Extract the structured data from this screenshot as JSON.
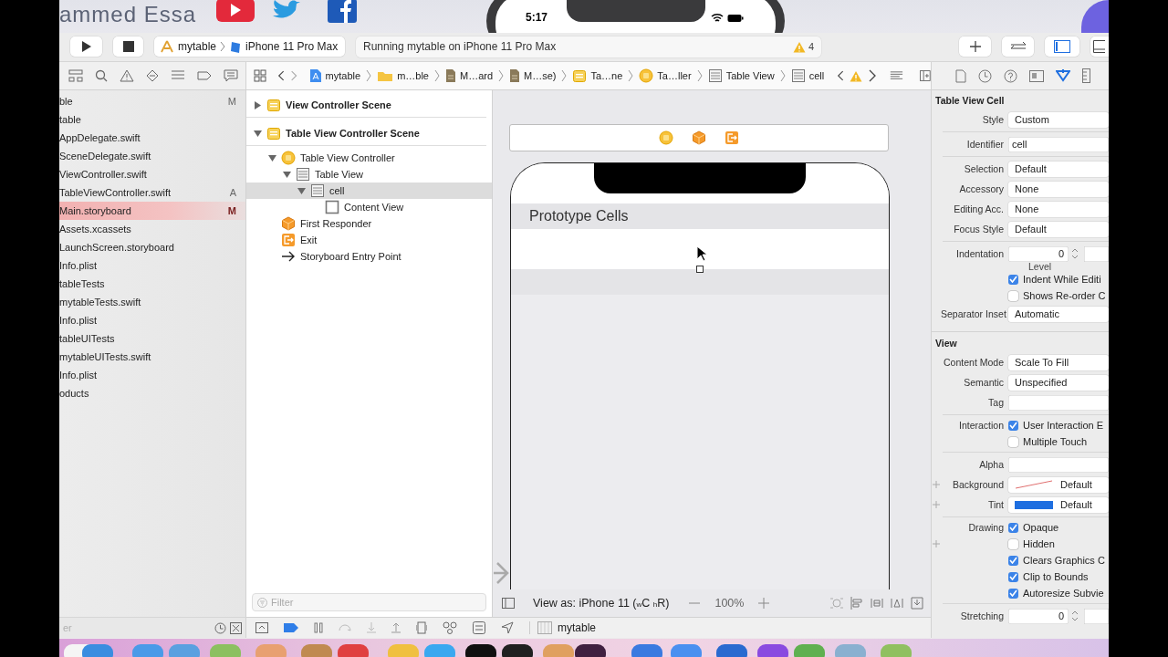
{
  "video_header": {
    "channel_name": "ammed Essa"
  },
  "simulator": {
    "time": "5:17"
  },
  "toolbar": {
    "scheme": "mytable",
    "device": "iPhone 11 Pro Max",
    "status": "Running mytable on iPhone 11 Pro Max",
    "warning_count": "4"
  },
  "jump_bar": {
    "path": [
      {
        "kind": "project",
        "label": "mytable"
      },
      {
        "kind": "folder",
        "label": "m…ble"
      },
      {
        "kind": "file",
        "label": "M…ard"
      },
      {
        "kind": "file",
        "label": "M…se)"
      },
      {
        "kind": "scene",
        "label": "Ta…ne"
      },
      {
        "kind": "controller",
        "label": "Ta…ller"
      },
      {
        "kind": "table",
        "label": "Table View"
      },
      {
        "kind": "table",
        "label": "cell"
      }
    ]
  },
  "navigator": {
    "files": [
      {
        "name": "ble",
        "badge": "M",
        "selected": false
      },
      {
        "name": "table",
        "selected": false
      },
      {
        "name": "AppDelegate.swift",
        "selected": false
      },
      {
        "name": "SceneDelegate.swift",
        "selected": false
      },
      {
        "name": "ViewController.swift",
        "selected": false
      },
      {
        "name": "TableViewController.swift",
        "badge": "A",
        "selected": false
      },
      {
        "name": "Main.storyboard",
        "badge": "M",
        "selected": true
      },
      {
        "name": "Assets.xcassets",
        "selected": false
      },
      {
        "name": "LaunchScreen.storyboard",
        "selected": false
      },
      {
        "name": "Info.plist",
        "selected": false
      },
      {
        "name": "tableTests",
        "selected": false
      },
      {
        "name": "mytableTests.swift",
        "selected": false
      },
      {
        "name": "Info.plist",
        "selected": false
      },
      {
        "name": "tableUITests",
        "selected": false
      },
      {
        "name": "mytableUITests.swift",
        "selected": false
      },
      {
        "name": "Info.plist",
        "selected": false
      },
      {
        "name": "oducts",
        "selected": false
      }
    ],
    "filter_placeholder": "er"
  },
  "outline": {
    "items": [
      {
        "kind": "scene",
        "label": "View Controller Scene",
        "expanded": false,
        "selected": false
      },
      {
        "kind": "scene",
        "label": "Table View Controller Scene",
        "expanded": true,
        "selected": false,
        "children": [
          {
            "kind": "controller",
            "label": "Table View Controller",
            "expanded": true,
            "selected": false,
            "children": [
              {
                "kind": "table",
                "label": "Table View",
                "expanded": true,
                "selected": false,
                "children": [
                  {
                    "kind": "table",
                    "label": "cell",
                    "expanded": true,
                    "selected": true,
                    "children": [
                      {
                        "kind": "view",
                        "label": "Content View",
                        "selected": false
                      }
                    ]
                  }
                ]
              }
            ]
          },
          {
            "kind": "responder",
            "label": "First Responder",
            "selected": false
          },
          {
            "kind": "exit",
            "label": "Exit",
            "selected": false
          },
          {
            "kind": "entry",
            "label": "Storyboard Entry Point",
            "selected": false
          }
        ]
      }
    ],
    "filter_placeholder": "Filter"
  },
  "canvas": {
    "section_header": "Prototype Cells",
    "view_as": "View as: iPhone 11 ($_{w}$C $_{h}$R)",
    "zoom": "100%"
  },
  "debug_bar": {
    "target": "mytable"
  },
  "inspector": {
    "sections": [
      {
        "title": "Table View Cell",
        "rows": [
          {
            "kind": "popup",
            "label": "Style",
            "value": "Custom"
          },
          {
            "kind": "divider"
          },
          {
            "kind": "field",
            "label": "Identifier",
            "value": "cell"
          },
          {
            "kind": "divider"
          },
          {
            "kind": "popup",
            "label": "Selection",
            "value": "Default"
          },
          {
            "kind": "popup",
            "label": "Accessory",
            "value": "None"
          },
          {
            "kind": "popup",
            "label": "Editing Acc.",
            "value": "None"
          },
          {
            "kind": "popup",
            "label": "Focus Style",
            "value": "Default"
          },
          {
            "kind": "divider"
          },
          {
            "kind": "stepper",
            "label": "Indentation",
            "value": "0",
            "sublabel": "Level"
          },
          {
            "kind": "checkbox",
            "text": "Indent While Editi",
            "checked": true
          },
          {
            "kind": "checkbox",
            "text": "Shows Re-order C",
            "checked": false
          },
          {
            "kind": "popup",
            "label": "Separator Inset",
            "value": "Automatic"
          }
        ]
      },
      {
        "title": "View",
        "rows": [
          {
            "kind": "popup",
            "label": "Content Mode",
            "value": "Scale To Fill"
          },
          {
            "kind": "popup",
            "label": "Semantic",
            "value": "Unspecified"
          },
          {
            "kind": "field",
            "label": "Tag"
          },
          {
            "kind": "divider"
          },
          {
            "kind": "checkbox",
            "label": "Interaction",
            "text": "User Interaction E",
            "checked": true
          },
          {
            "kind": "checkbox",
            "text": "Multiple Touch",
            "checked": false
          },
          {
            "kind": "divider"
          },
          {
            "kind": "field",
            "label": "Alpha"
          },
          {
            "kind": "color",
            "label": "Background",
            "value": "Default",
            "plus": true
          },
          {
            "kind": "color",
            "label": "Tint",
            "value": "Default",
            "plus": true,
            "color": "#1f6fe0"
          },
          {
            "kind": "divider"
          },
          {
            "kind": "checkbox",
            "label": "Drawing",
            "text": "Opaque",
            "checked": true
          },
          {
            "kind": "checkbox",
            "text": "Hidden",
            "checked": false,
            "plus": true
          },
          {
            "kind": "checkbox",
            "text": "Clears Graphics C",
            "checked": true
          },
          {
            "kind": "checkbox",
            "text": "Clip to Bounds",
            "checked": true
          },
          {
            "kind": "checkbox",
            "text": "Autoresize Subvie",
            "checked": true
          },
          {
            "kind": "divider"
          },
          {
            "kind": "stepper",
            "label": "Stretching",
            "value": "0"
          }
        ]
      }
    ]
  }
}
